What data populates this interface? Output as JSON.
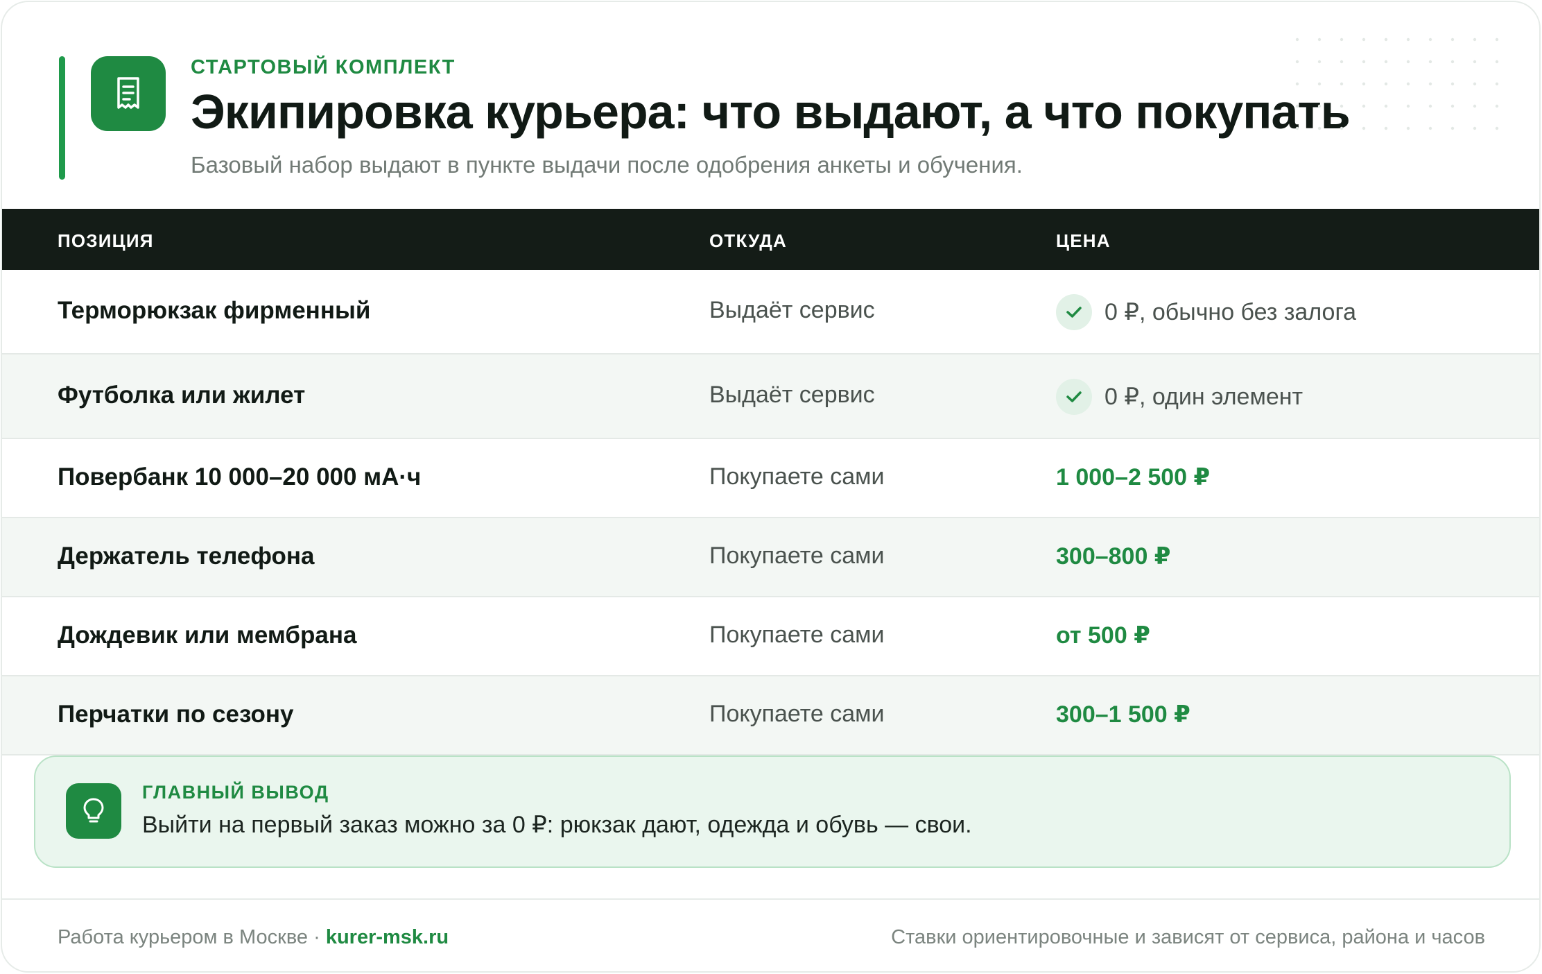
{
  "header": {
    "eyebrow": "СТАРТОВЫЙ КОМПЛЕКТ",
    "title": "Экипировка курьера: что выдают, а что покупать",
    "subtitle": "Базовый набор выдают в пункте выдачи после одобрения анкеты и обучения.",
    "icon": "receipt-icon"
  },
  "table": {
    "columns": [
      "ПОЗИЦИЯ",
      "ОТКУДА",
      "ЦЕНА"
    ],
    "rows": [
      {
        "name": "Терморюкзак фирменный",
        "source": "Выдаёт сервис",
        "price": "0 ₽, обычно без залога",
        "style": "check"
      },
      {
        "name": "Футболка или жилет",
        "source": "Выдаёт сервис",
        "price": "0 ₽, один элемент",
        "style": "check"
      },
      {
        "name": "Повербанк 10 000–20 000 мА·ч",
        "source": "Покупаете сами",
        "price": "1 000–2 500 ₽",
        "style": "green"
      },
      {
        "name": "Держатель телефона",
        "source": "Покупаете сами",
        "price": "300–800 ₽",
        "style": "green"
      },
      {
        "name": "Дождевик или мембрана",
        "source": "Покупаете сами",
        "price": "от 500 ₽",
        "style": "green"
      },
      {
        "name": "Перчатки по сезону",
        "source": "Покупаете сами",
        "price": "300–1 500 ₽",
        "style": "green"
      }
    ]
  },
  "callout": {
    "label": "ГЛАВНЫЙ ВЫВОД",
    "text": "Выйти на первый заказ можно за 0 ₽: рюкзак дают, одежда и обувь — свои.",
    "icon": "lightbulb-icon"
  },
  "footer": {
    "left_text": "Работа курьером в Москве · ",
    "site": "kurer-msk.ru",
    "right_text": "Ставки ориентировочные и зависят от сервиса, района и часов"
  },
  "colors": {
    "accent": "#1f8a42",
    "header_bg": "#141c17",
    "row_alt": "#f3f7f4"
  }
}
